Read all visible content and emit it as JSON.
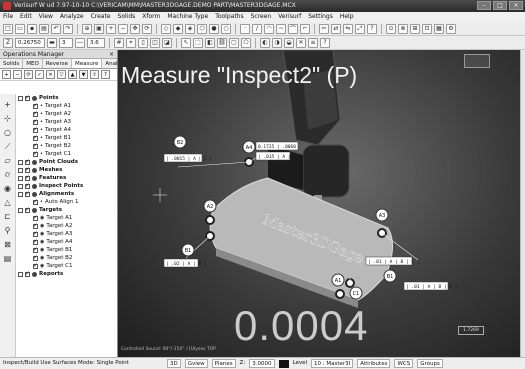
{
  "window": {
    "title": "Verisurf  W  ud 7.97-10-10  C:\\VERICAM\\MM\\MASTER3DGAGE.DEMO PART\\MASTER3DGAGE.MCX",
    "buttons": [
      "–",
      "□",
      "×"
    ]
  },
  "menu": [
    "File",
    "Edit",
    "View",
    "Analyze",
    "Create",
    "Solids",
    "Xform",
    "Machine Type",
    "Toolpaths",
    "Screen",
    "Verisurf",
    "Settings",
    "Help"
  ],
  "toolbar2": {
    "z_field": "0.26750",
    "level_field": "3",
    "style_field": "3.6"
  },
  "panel": {
    "title": "Operations Manager",
    "close": "×",
    "tabs": [
      "Solids",
      "MEO",
      "Reverse",
      "Measure",
      "Analysis"
    ],
    "active_tab": "Measure"
  },
  "tree": [
    {
      "label": "Points",
      "level": 0,
      "type": "group",
      "bold": true
    },
    {
      "label": "Target A1",
      "level": 1,
      "type": "item"
    },
    {
      "label": "Target A2",
      "level": 1,
      "type": "item"
    },
    {
      "label": "Target A3",
      "level": 1,
      "type": "item"
    },
    {
      "label": "Target A4",
      "level": 1,
      "type": "item"
    },
    {
      "label": "Target B1",
      "level": 1,
      "type": "item"
    },
    {
      "label": "Target B2",
      "level": 1,
      "type": "item"
    },
    {
      "label": "Target C1",
      "level": 1,
      "type": "item"
    },
    {
      "label": "Point Clouds",
      "level": 0,
      "type": "group",
      "bold": true
    },
    {
      "label": "Meshes",
      "level": 0,
      "type": "group",
      "bold": true
    },
    {
      "label": "Features",
      "level": 0,
      "type": "group",
      "bold": true
    },
    {
      "label": "Inspect Points",
      "level": 0,
      "type": "group",
      "bold": true
    },
    {
      "label": "Alignments",
      "level": 0,
      "type": "group",
      "bold": true
    },
    {
      "label": "Auto Align 1",
      "level": 1,
      "type": "item"
    },
    {
      "label": "Targets",
      "level": 0,
      "type": "group",
      "bold": true
    },
    {
      "label": "Target A1",
      "level": 1,
      "type": "target"
    },
    {
      "label": "Target A2",
      "level": 1,
      "type": "target"
    },
    {
      "label": "Target A3",
      "level": 1,
      "type": "target"
    },
    {
      "label": "Target A4",
      "level": 1,
      "type": "target"
    },
    {
      "label": "Target B1",
      "level": 1,
      "type": "target"
    },
    {
      "label": "Target B2",
      "level": 1,
      "type": "target"
    },
    {
      "label": "Target C1",
      "level": 1,
      "type": "target"
    },
    {
      "label": "Reports",
      "level": 0,
      "type": "group",
      "bold": true
    }
  ],
  "viewport": {
    "title": "Measure \"Inspect2\" (P)",
    "reading": "0.0004",
    "part_label": "Master3DGage",
    "scale_label": "1.7269",
    "status_text": "Controlled Sound: 90°/-150° / [Ulyses TOP"
  },
  "markers": [
    {
      "label": "A4"
    },
    {
      "label": "B2"
    },
    {
      "label": "A2"
    },
    {
      "label": "B1"
    },
    {
      "label": "A3"
    },
    {
      "label": "A1"
    },
    {
      "label": "C1"
    },
    {
      "label": "B1"
    }
  ],
  "callouts": [
    {
      "text": "0.1725 | .0060"
    },
    {
      "text": "| .0015 | A | C |"
    },
    {
      "text": "| .015 | A | C |"
    },
    {
      "text": "| .02 | A | B |"
    },
    {
      "text": "| .01 | A | B | C |"
    },
    {
      "text": "| .01 | A | B | C |"
    }
  ],
  "statusbar": {
    "left": "Inspect/Build Use Surfaces Mode: Single Point",
    "mode": "3D",
    "gview": "Gview",
    "planes": "Planes",
    "z_label": "Z:",
    "z_value": "3.0000",
    "level_label": "Level",
    "level_value": "10 : Master3I",
    "attributes": "Attributes",
    "wcs": "WCS",
    "groups": "Groups"
  }
}
